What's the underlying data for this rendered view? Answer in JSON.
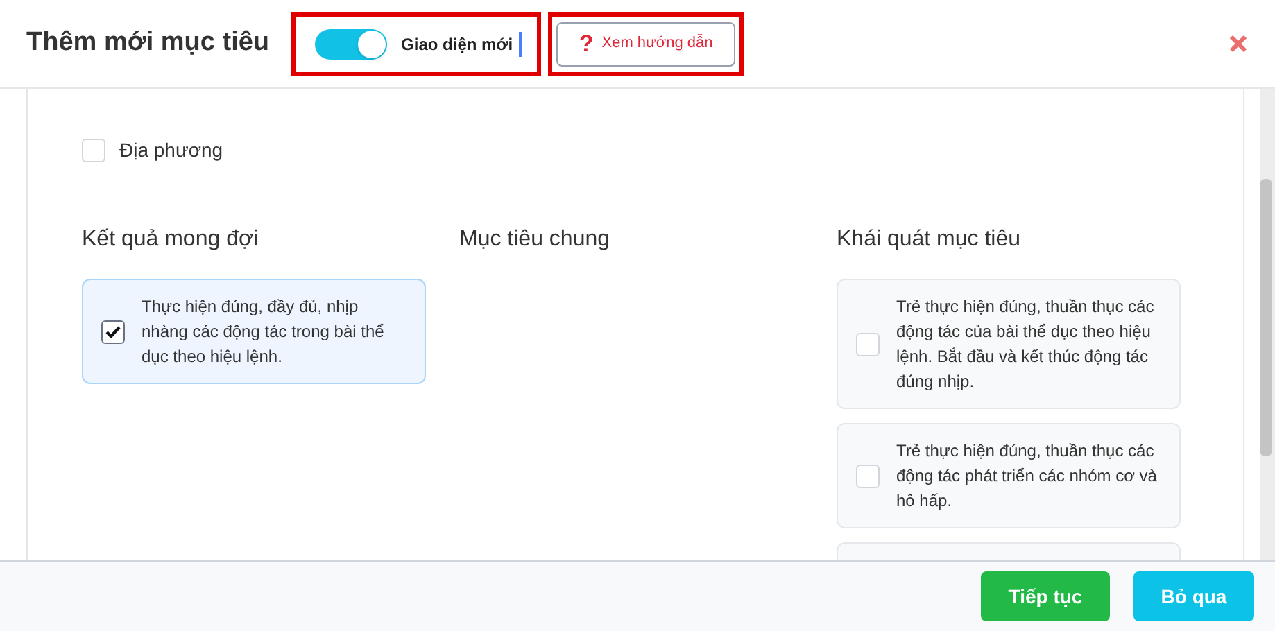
{
  "header": {
    "title": "Thêm mới mục tiêu",
    "toggle": {
      "label": "Giao diện mới",
      "on": true
    },
    "help_button": {
      "icon": "?",
      "label": "Xem hướng dẫn"
    }
  },
  "local_option": {
    "label": "Địa phương",
    "checked": false
  },
  "columns": [
    {
      "heading": "Kết quả mong đợi",
      "items": [
        {
          "text": "Thực hiện đúng, đầy đủ, nhịp nhàng các động tác trong bài thể dục theo hiệu lệnh.",
          "checked": true
        }
      ]
    },
    {
      "heading": "Mục tiêu chung"
    },
    {
      "heading": "Khái quát mục tiêu",
      "items": [
        {
          "text": "Trẻ thực hiện đúng, thuần thục các động tác của bài thể dục theo hiệu lệnh. Bắt đầu và kết thúc động tác đúng nhịp.",
          "checked": false
        },
        {
          "text": "Trẻ thực hiện đúng, thuần thục các động tác phát triển các nhóm cơ và hô hấp.",
          "checked": false
        }
      ],
      "more_below": true
    }
  ],
  "footer": {
    "buttons": [
      {
        "label": "Tiếp tục",
        "kind": "primary"
      },
      {
        "label": "Bỏ qua",
        "kind": "secondary"
      }
    ]
  }
}
